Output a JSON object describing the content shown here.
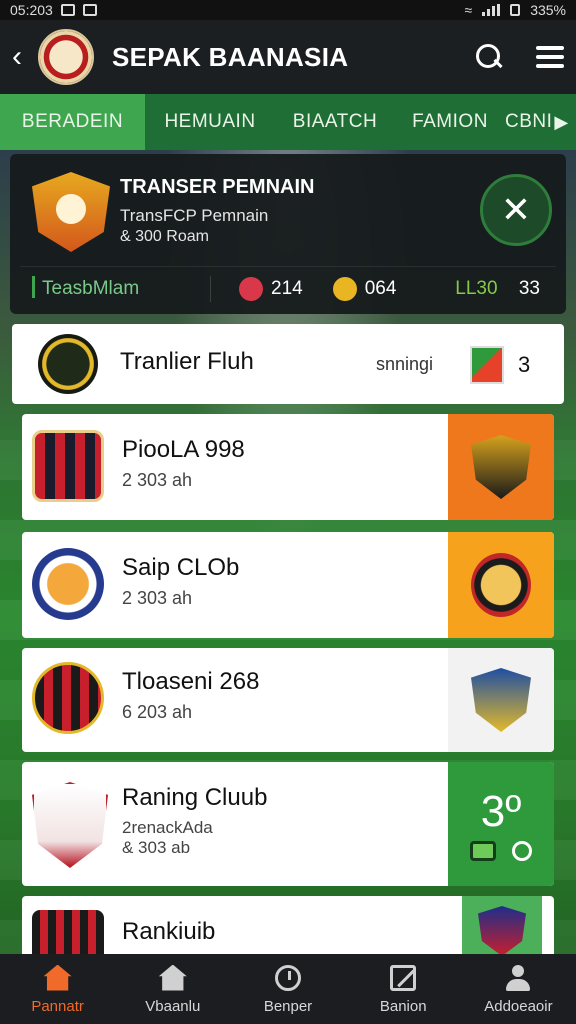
{
  "status_bar": {
    "time": "05:203",
    "battery": "335%"
  },
  "app_bar": {
    "title": "SEPAK BAANASIA"
  },
  "tabs": [
    {
      "label": "BERADEIN",
      "active": true
    },
    {
      "label": "HEMUAIN"
    },
    {
      "label": "BIAATCH"
    },
    {
      "label": "FAMION"
    },
    {
      "label": "CBNI"
    }
  ],
  "featured": {
    "title": "TRANSER PEMNAIN",
    "subtitle": "TransFCP Pemnain",
    "meta": "& 300 Roam",
    "stats_label": "TeasbMlam",
    "stat1": "214",
    "stat2": "064",
    "stat3_a": "LL30",
    "stat3_b": "33"
  },
  "list": [
    {
      "name": "Tranlier Fluh",
      "rank_label": "snningi",
      "rank": "3"
    },
    {
      "name": "PiooLA 998",
      "sub": "2 303 ah"
    },
    {
      "name": "Saip CLOb",
      "sub": "2 303 ah"
    },
    {
      "name": "Tloaseni 268",
      "sub": "6 203 ah"
    },
    {
      "name": "Raning Cluub",
      "sub": "2renackAda",
      "sub2": "& 303 ab",
      "thumb_value": "3º"
    },
    {
      "name": "Rankiuib"
    }
  ],
  "bottom_nav": [
    {
      "label": "Pannatr",
      "active": true
    },
    {
      "label": "Vbaanlu"
    },
    {
      "label": "Benper"
    },
    {
      "label": "Banion"
    },
    {
      "label": "Addoeaoir"
    }
  ],
  "colors": {
    "accent": "#3fa650",
    "nav_active": "#f06a2a",
    "header": "#1b1f22"
  }
}
